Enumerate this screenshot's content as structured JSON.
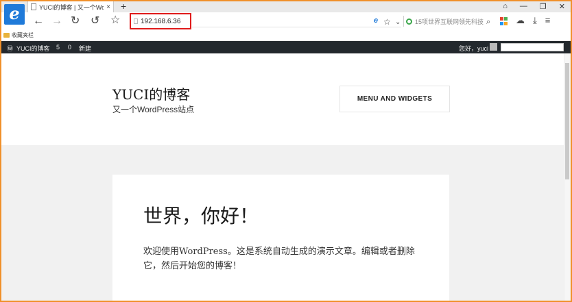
{
  "browser": {
    "tab_title": "YUCI的博客 | 又一个Word",
    "tab_close": "×",
    "new_tab": "+",
    "window_controls": [
      "⌂",
      "—",
      "❐",
      "✕"
    ],
    "address": "192.168.6.36",
    "search_placeholder": "15项世界互联网领先科技",
    "favorites_label": "收藏夹栏"
  },
  "adminbar": {
    "site_name": "YUCI的博客",
    "updates": "5",
    "comments": "0",
    "new_label": "新建",
    "greeting": "您好，yuci"
  },
  "site": {
    "title": "YUCI的博客",
    "description": "又一个WordPress站点",
    "menu_label": "MENU AND WIDGETS"
  },
  "post": {
    "title": "世界，你好！",
    "body": "欢迎使用WordPress。这是系统自动生成的演示文章。编辑或者删除它，然后开始您的博客！"
  },
  "colors": {
    "highlight": "#e01b1b",
    "frame": "#f0902a",
    "adminbar": "#23282d",
    "ie_blue": "#1f7ad9"
  }
}
